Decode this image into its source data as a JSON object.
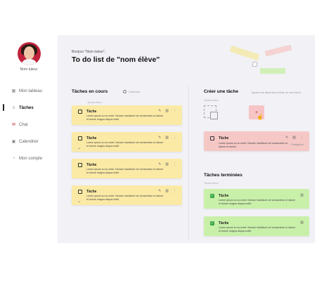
{
  "sidebar": {
    "tutor_name": "Nom tuteur",
    "items": [
      {
        "label": "Mon tableau",
        "icon": "grid-icon"
      },
      {
        "label": "Tâches",
        "icon": "bars-icon",
        "active": true
      },
      {
        "label": "Chat",
        "icon": "chat-icon"
      },
      {
        "label": "Calendrier",
        "icon": "calendar-icon"
      },
      {
        "label": "Mon compte",
        "icon": "user-icon"
      }
    ]
  },
  "header": {
    "greeting": "Bonjour \"Nom tuteur\",",
    "title": "To do list de \"nom élève\""
  },
  "in_progress": {
    "title": "Tâches en cours",
    "search_placeholder": "Chercher",
    "group_label": "Tâches élève",
    "cards": [
      {
        "title": "Tâche",
        "desc": "Lorem ipsum su eu ectet. Nenam incididunt vel consectetur ut labore et dolore magna aliqua mollit."
      },
      {
        "title": "Tâche",
        "desc": "Lorem ipsum su eu ectet. Nenam incididunt vel consectetur ut labore et dolore magna aliqua mollit."
      },
      {
        "title": "Tâche",
        "desc": "Lorem ipsum su eu ectet. Nenam incididunt vel consectetur ut labore et dolore magna aliqua mollit."
      },
      {
        "title": "Tâche",
        "desc": "Lorem ipsum su eu ectet. Nenam incididunt vel consectetur ut labore et dolore magna aliqua mollit."
      }
    ]
  },
  "create": {
    "title": "Créer une tâche",
    "note": "Ajouter une tâche dans la liste de votre élève",
    "label": "Tâches élève",
    "add_symbol": "+",
    "draft": {
      "title": "Tâche",
      "desc": "Lorem ipsum su eu ectet. Nenam incididunt vel consectetur ut labore et dolore.",
      "save": "Enregistrer"
    }
  },
  "done": {
    "title": "Tâches terminées",
    "label": "Tâches élève",
    "cards": [
      {
        "title": "Tâche",
        "desc": "Lorem ipsum su eu ectet. Nenam incididunt vel consectetur ut labore et dolore magna aliqua mollit."
      },
      {
        "title": "Tâche",
        "desc": "Lorem ipsum su eu ectet. Nenam incididunt vel consectetur ut labore et dolore magna aliqua mollit."
      }
    ]
  },
  "colors": {
    "yellow_card": "#fbeaa6",
    "pink_card": "#f5c8c6",
    "green_card": "#c9f0a9",
    "accent_red": "#c0233b",
    "background": "#f1f1f6"
  }
}
